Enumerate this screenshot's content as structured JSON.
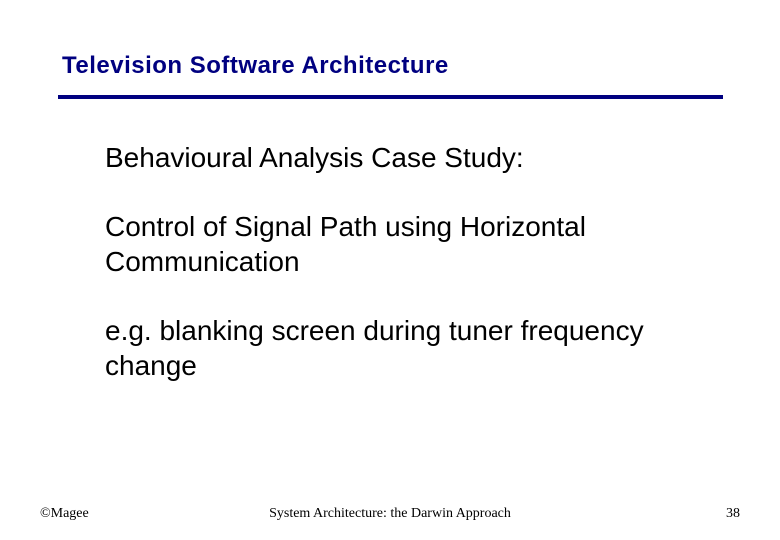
{
  "title": "Television Software Architecture",
  "body": {
    "p1": "Behavioural Analysis Case Study:",
    "p2": "Control of Signal Path using Horizontal Communication",
    "p3": "e.g. blanking screen during tuner frequency change"
  },
  "footer": {
    "left": "©Magee",
    "center": "System Architecture: the Darwin Approach",
    "right": "38"
  }
}
